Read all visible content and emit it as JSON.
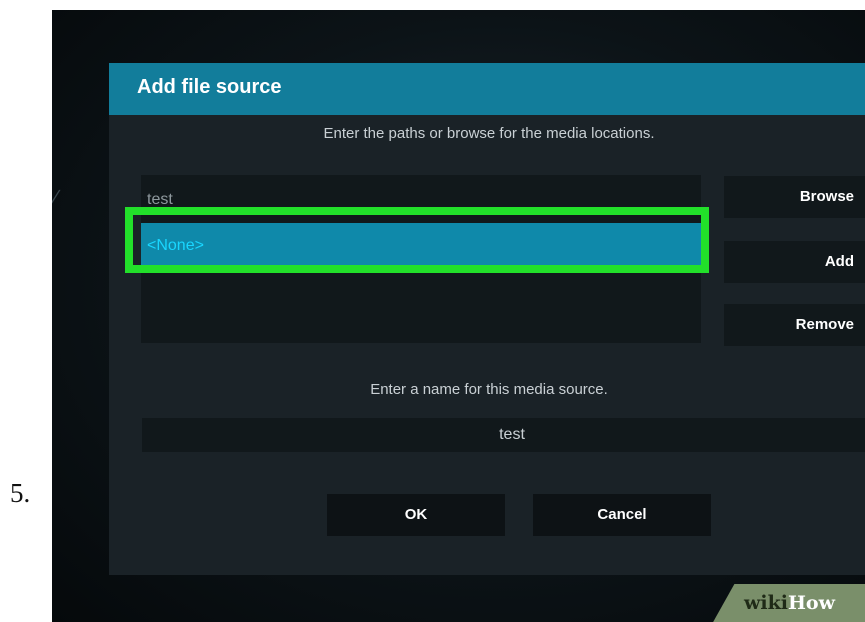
{
  "step_number": "5.",
  "background_glyph": "∕",
  "dialog": {
    "title": "Add file source",
    "paths_instruction": "Enter the paths or browse for the media locations.",
    "paths": [
      "test",
      "<None>"
    ],
    "side_buttons": {
      "browse": "Browse",
      "add": "Add",
      "remove": "Remove"
    },
    "name_instruction": "Enter a name for this media source.",
    "name_value": "test",
    "buttons": {
      "ok": "OK",
      "cancel": "Cancel"
    }
  },
  "watermark": {
    "part1": "wiki",
    "part2": "How"
  },
  "colors": {
    "header": "#127d9b",
    "selected_row": "#0f89aa",
    "highlight": "#22e02a"
  }
}
